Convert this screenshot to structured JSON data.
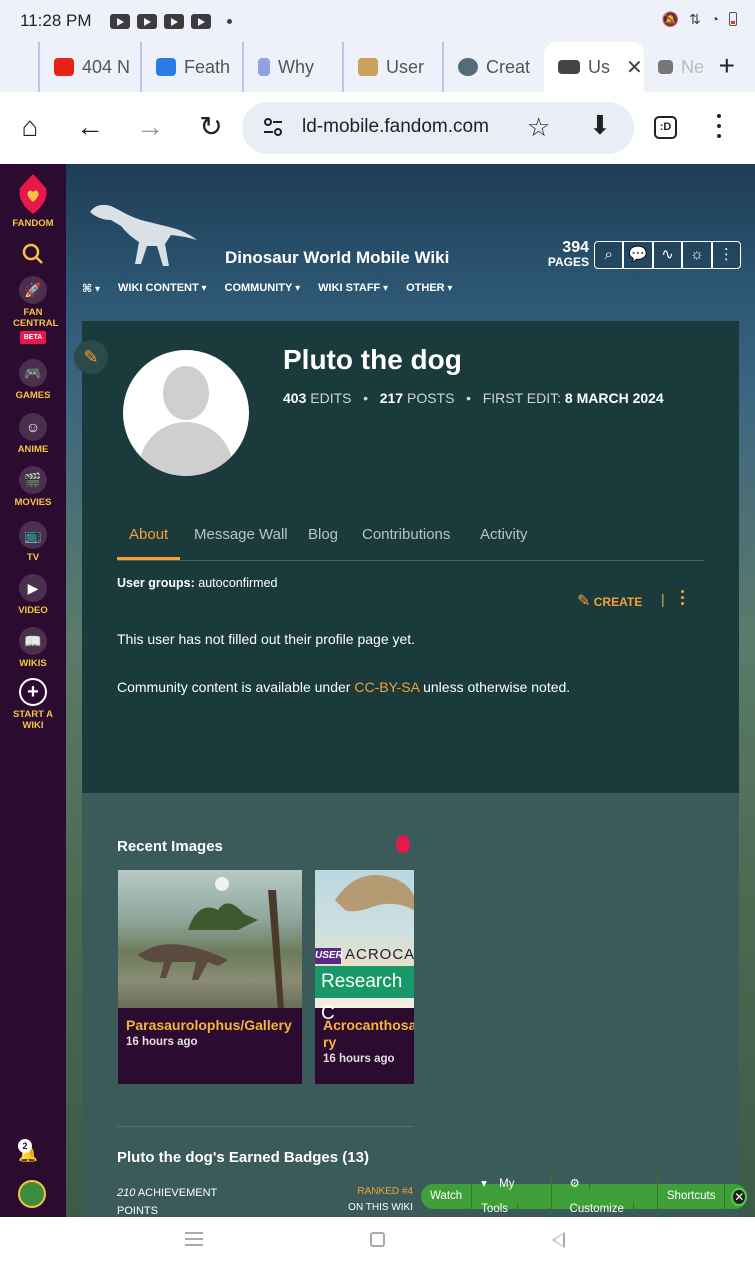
{
  "status_bar": {
    "time": "11:28 PM",
    "system_icons": "🔕 ⇅ ◔"
  },
  "browser": {
    "tabs": [
      {
        "label": "404 N",
        "color": "#e62117"
      },
      {
        "label": "Feath",
        "color": "#2c7be5"
      },
      {
        "label": "Why",
        "color": "#8fa3e0"
      },
      {
        "label": "User",
        "color": "#c9a15a"
      },
      {
        "label": "Creat",
        "color": "#556b7a"
      },
      {
        "label": "Us",
        "color": "#444"
      },
      {
        "label": "Ne",
        "color": "#777"
      }
    ],
    "url": "ld-mobile.fandom.com",
    "tab_switch_label": ":D"
  },
  "rail": {
    "items": [
      {
        "label": "FANDOM",
        "icon": "fandom-heart-icon"
      },
      {
        "label": "",
        "icon": "search-icon"
      },
      {
        "label": "FAN CENTRAL",
        "icon": "rocket-icon",
        "badge": "BETA"
      },
      {
        "label": "GAMES",
        "icon": "controller-icon"
      },
      {
        "label": "ANIME",
        "icon": "face-icon"
      },
      {
        "label": "MOVIES",
        "icon": "clapperboard-icon"
      },
      {
        "label": "TV",
        "icon": "tv-icon"
      },
      {
        "label": "VIDEO",
        "icon": "play-icon"
      },
      {
        "label": "WIKIS",
        "icon": "book-icon"
      },
      {
        "label": "START A WIKI",
        "icon": "plus-circle-icon"
      }
    ],
    "notification_count": "2"
  },
  "wiki": {
    "name": "Dinosaur World Mobile Wiki",
    "pages_count": "394",
    "pages_label": "PAGES",
    "nav": [
      "WIKI CONTENT",
      "COMMUNITY",
      "WIKI STAFF",
      "OTHER"
    ]
  },
  "profile": {
    "username": "Pluto the dog",
    "edits_count": "403",
    "edits_label": "EDITS",
    "posts_count": "217",
    "posts_label": "POSTS",
    "first_edit_label": "FIRST EDIT:",
    "first_edit_date": "8 MARCH 2024",
    "tabs": [
      "About",
      "Message Wall",
      "Blog",
      "Contributions",
      "Activity"
    ],
    "user_groups_label": "User groups:",
    "user_groups_value": "autoconfirmed",
    "create_label": "CREATE",
    "empty_text": "This user has not filled out their profile page yet.",
    "license_pre": "Community content is available under",
    "license_link": "CC-BY-SA",
    "license_post": "unless otherwise noted."
  },
  "recent_images": {
    "heading": "Recent Images",
    "items": [
      {
        "title": "Parasaurolophus/Gallery",
        "time": "16 hours ago"
      },
      {
        "title_line1": "Acrocanthosa",
        "title_line2": "ry",
        "time": "16 hours ago",
        "overlay_tag": "USER",
        "overlay_title": "ACROCA",
        "overlay_banner": "Research C"
      }
    ]
  },
  "badges": {
    "heading": "Pluto the dog's Earned Badges (13)",
    "points_value": "210",
    "points_label_1": "ACHIEVEMENT",
    "points_label_2": "POINTS",
    "ranked_label": "RANKED #4",
    "ranked_scope": "ON THIS WIKI"
  },
  "global_tools": [
    "Watch",
    "My Tools",
    "Customize",
    "Shortcuts"
  ]
}
